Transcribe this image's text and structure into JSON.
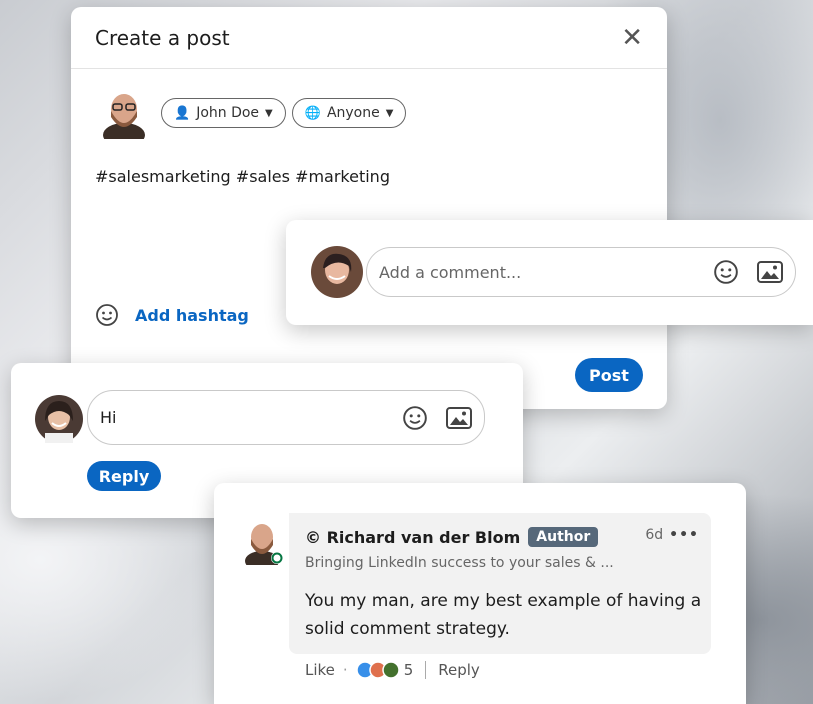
{
  "create_post": {
    "title": "Create a post",
    "close_icon": "close-icon",
    "author_label": "John Doe",
    "audience_label": "Anyone",
    "post_text": "#salesmarketing #sales #marketing",
    "add_hashtag_label": "Add hashtag",
    "post_label": "Post"
  },
  "comment_box": {
    "placeholder": "Add a comment..."
  },
  "reply_box": {
    "input_value": "Hi",
    "reply_label": "Reply"
  },
  "comment": {
    "author": "© Richard van der Blom",
    "author_badge": "Author",
    "time": "6d",
    "more": "•••",
    "headline": "Bringing LinkedIn success to your sales & ...",
    "text": "You my man, are my best example of having a solid comment strategy.",
    "like_label": "Like",
    "dot": "·",
    "reaction_count": "5",
    "reply_label": "Reply"
  },
  "colors": {
    "accent": "#0a66c2",
    "badge": "#56687a"
  }
}
